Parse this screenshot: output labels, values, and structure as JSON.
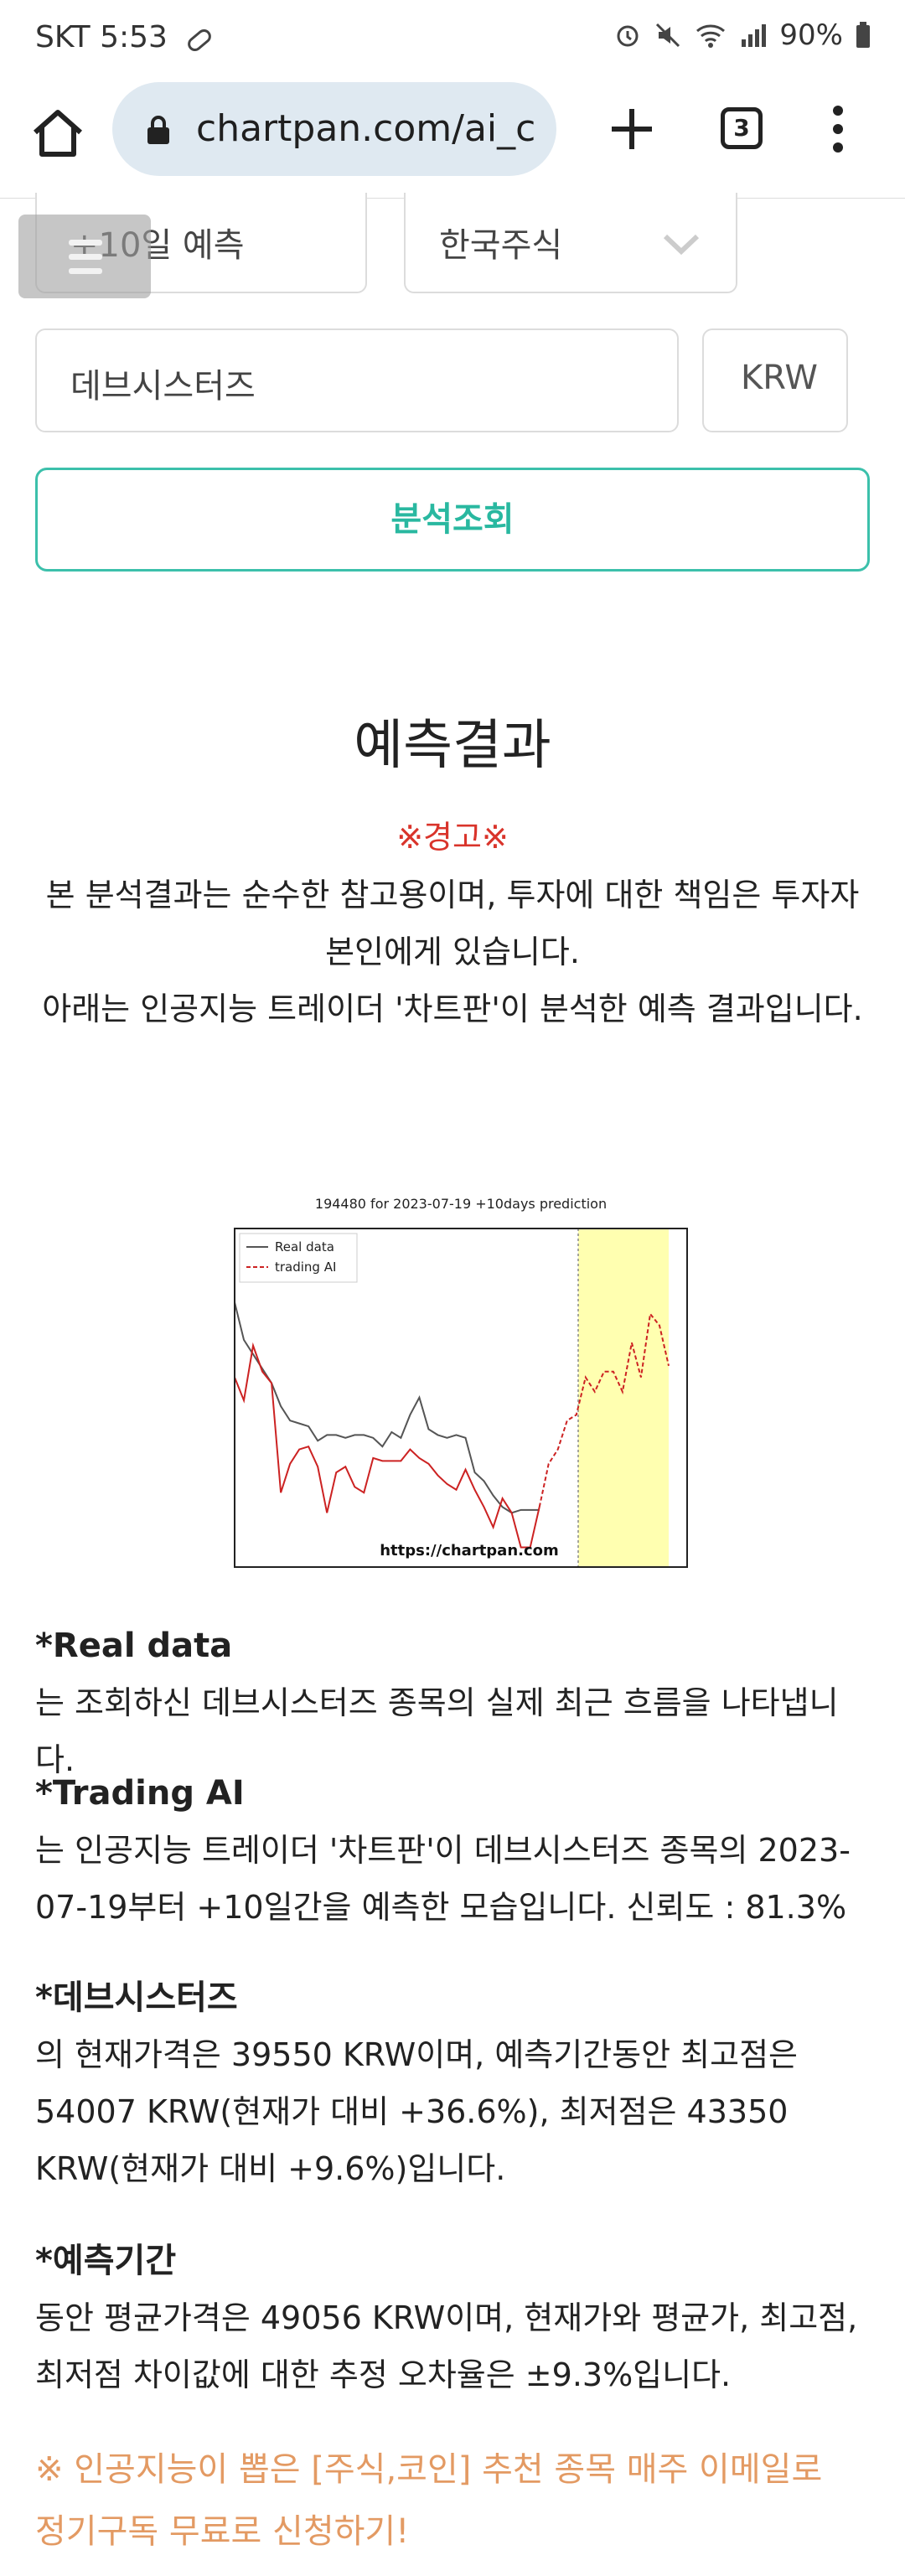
{
  "status_bar": {
    "carrier_time": "SKT 5:53",
    "battery": "90%",
    "icons": [
      "pill-icon",
      "alarm-icon",
      "mute-icon",
      "wifi-icon",
      "signal-icon",
      "battery-icon"
    ]
  },
  "browser": {
    "url": "chartpan.com/ai_c",
    "tab_count": "3"
  },
  "form": {
    "period_select": "+10일 예측",
    "market_select": "한국주식",
    "stock_input": "데브시스터즈",
    "currency": "KRW",
    "analyze_button": "분석조회"
  },
  "results": {
    "title": "예측결과",
    "warning": "※경고※",
    "disclaimer_line1": "본 분석결과는 순수한 참고용이며, 투자에 대한 책임은 투자자",
    "disclaimer_line2": "본인에게 있습니다.",
    "disclaimer_line3": "아래는 인공지능 트레이더 '차트판'이 분석한 예측 결과입니다."
  },
  "chart_data": {
    "type": "line",
    "title": "194480 for 2023-07-19 +10days prediction",
    "watermark": "https://chartpan.com",
    "legend": [
      "Real data",
      "trading AI"
    ],
    "legend_position": "top-left",
    "prediction_region_color": "#ffffb0",
    "series": [
      {
        "name": "Real data",
        "color": "#555555",
        "style": "solid",
        "values": [
          0.86,
          0.73,
          0.68,
          0.63,
          0.58,
          0.5,
          0.45,
          0.44,
          0.43,
          0.38,
          0.4,
          0.4,
          0.39,
          0.4,
          0.4,
          0.39,
          0.36,
          0.41,
          0.39,
          0.47,
          0.53,
          0.42,
          0.4,
          0.39,
          0.4,
          0.39,
          0.27,
          0.24,
          0.19,
          0.15,
          0.13,
          0.14,
          0.14,
          0.14
        ]
      },
      {
        "name": "trading AI",
        "color": "#cc2222",
        "style": "dashed-after-split",
        "values": [
          0.6,
          0.52,
          0.71,
          0.62,
          0.58,
          0.2,
          0.3,
          0.35,
          0.36,
          0.29,
          0.13,
          0.27,
          0.29,
          0.22,
          0.2,
          0.32,
          0.31,
          0.31,
          0.31,
          0.35,
          0.32,
          0.3,
          0.26,
          0.23,
          0.21,
          0.28,
          0.21,
          0.15,
          0.08,
          0.18,
          0.13,
          0.01,
          0.01,
          0.15,
          0.3,
          0.35,
          0.45,
          0.47,
          0.6,
          0.55,
          0.62,
          0.62,
          0.55,
          0.72,
          0.6,
          0.82,
          0.78,
          0.64
        ]
      }
    ],
    "split_index": 33
  },
  "sections": [
    {
      "head": "*Real data",
      "body": "는 조회하신 데브시스터즈 종목의 실제 최근 흐름을 나타냅니다."
    },
    {
      "head": "*Trading AI",
      "body": "는 인공지능 트레이더 '차트판'이 데브시스터즈 종목의 2023-07-19부터 +10일간을 예측한 모습입니다. 신뢰도 : 81.3%"
    },
    {
      "head": "*데브시스터즈",
      "body": "의 현재가격은 39550 KRW이며, 예측기간동안 최고점은 54007 KRW(현재가 대비 +36.6%), 최저점은 43350 KRW(현재가 대비 +9.6%)입니다."
    },
    {
      "head": "*예측기간",
      "body": "동안 평균가격은 49056 KRW이며, 현재가와 평균가, 최고점, 최저점 차이값에 대한 추정 오차율은 ±9.3%입니다."
    }
  ],
  "promo": "※ 인공지능이 뽑은 [주식,코인] 추천 종목 매주 이메일로 정기구독 무료로 신청하기!"
}
